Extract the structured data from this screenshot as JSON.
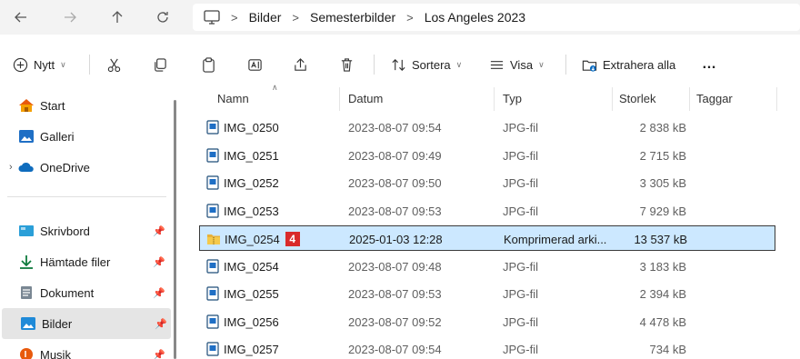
{
  "address_bar": {
    "breadcrumbs": [
      "Bilder",
      "Semesterbilder",
      "Los Angeles 2023"
    ],
    "separator": ">"
  },
  "toolbar": {
    "new_label": "Nytt",
    "sort_label": "Sortera",
    "view_label": "Visa",
    "extract_label": "Extrahera alla",
    "more_label": "…"
  },
  "sidebar": {
    "items": [
      {
        "label": "Start",
        "icon": "home-icon"
      },
      {
        "label": "Galleri",
        "icon": "gallery-icon"
      },
      {
        "label": "OneDrive",
        "icon": "cloud-icon"
      },
      {
        "label": "Skrivbord",
        "icon": "desktop-icon",
        "pinned": true
      },
      {
        "label": "Hämtade filer",
        "icon": "download-icon",
        "pinned": true
      },
      {
        "label": "Dokument",
        "icon": "document-icon",
        "pinned": true
      },
      {
        "label": "Bilder",
        "icon": "pictures-icon",
        "pinned": true,
        "selected": true
      },
      {
        "label": "Musik",
        "icon": "music-icon",
        "pinned": true
      }
    ]
  },
  "columns": {
    "name": "Namn",
    "date": "Datum",
    "type": "Typ",
    "size": "Storlek",
    "tags": "Taggar"
  },
  "files": [
    {
      "name": "IMG_0250",
      "date": "2023-08-07 09:54",
      "type": "JPG-fil",
      "size": "2 838 kB"
    },
    {
      "name": "IMG_0251",
      "date": "2023-08-07 09:49",
      "type": "JPG-fil",
      "size": "2 715 kB"
    },
    {
      "name": "IMG_0252",
      "date": "2023-08-07 09:50",
      "type": "JPG-fil",
      "size": "3 305 kB"
    },
    {
      "name": "IMG_0253",
      "date": "2023-08-07 09:53",
      "type": "JPG-fil",
      "size": "7 929 kB"
    },
    {
      "name": "IMG_0254",
      "date": "2025-01-03 12:28",
      "type": "Komprimerad arki...",
      "size": "13 537 kB",
      "selected": true,
      "zip": true,
      "badge": "4"
    },
    {
      "name": "IMG_0254",
      "date": "2023-08-07 09:48",
      "type": "JPG-fil",
      "size": "3 183 kB"
    },
    {
      "name": "IMG_0255",
      "date": "2023-08-07 09:53",
      "type": "JPG-fil",
      "size": "2 394 kB"
    },
    {
      "name": "IMG_0256",
      "date": "2023-08-07 09:52",
      "type": "JPG-fil",
      "size": "4 478 kB"
    },
    {
      "name": "IMG_0257",
      "date": "2023-08-07 09:54",
      "type": "JPG-fil",
      "size": "734 kB"
    }
  ],
  "colors": {
    "selection_bg": "#cce8ff",
    "accent": "#0067c0",
    "badge": "#d92a2a",
    "zip_folder": "#e8b13a"
  }
}
